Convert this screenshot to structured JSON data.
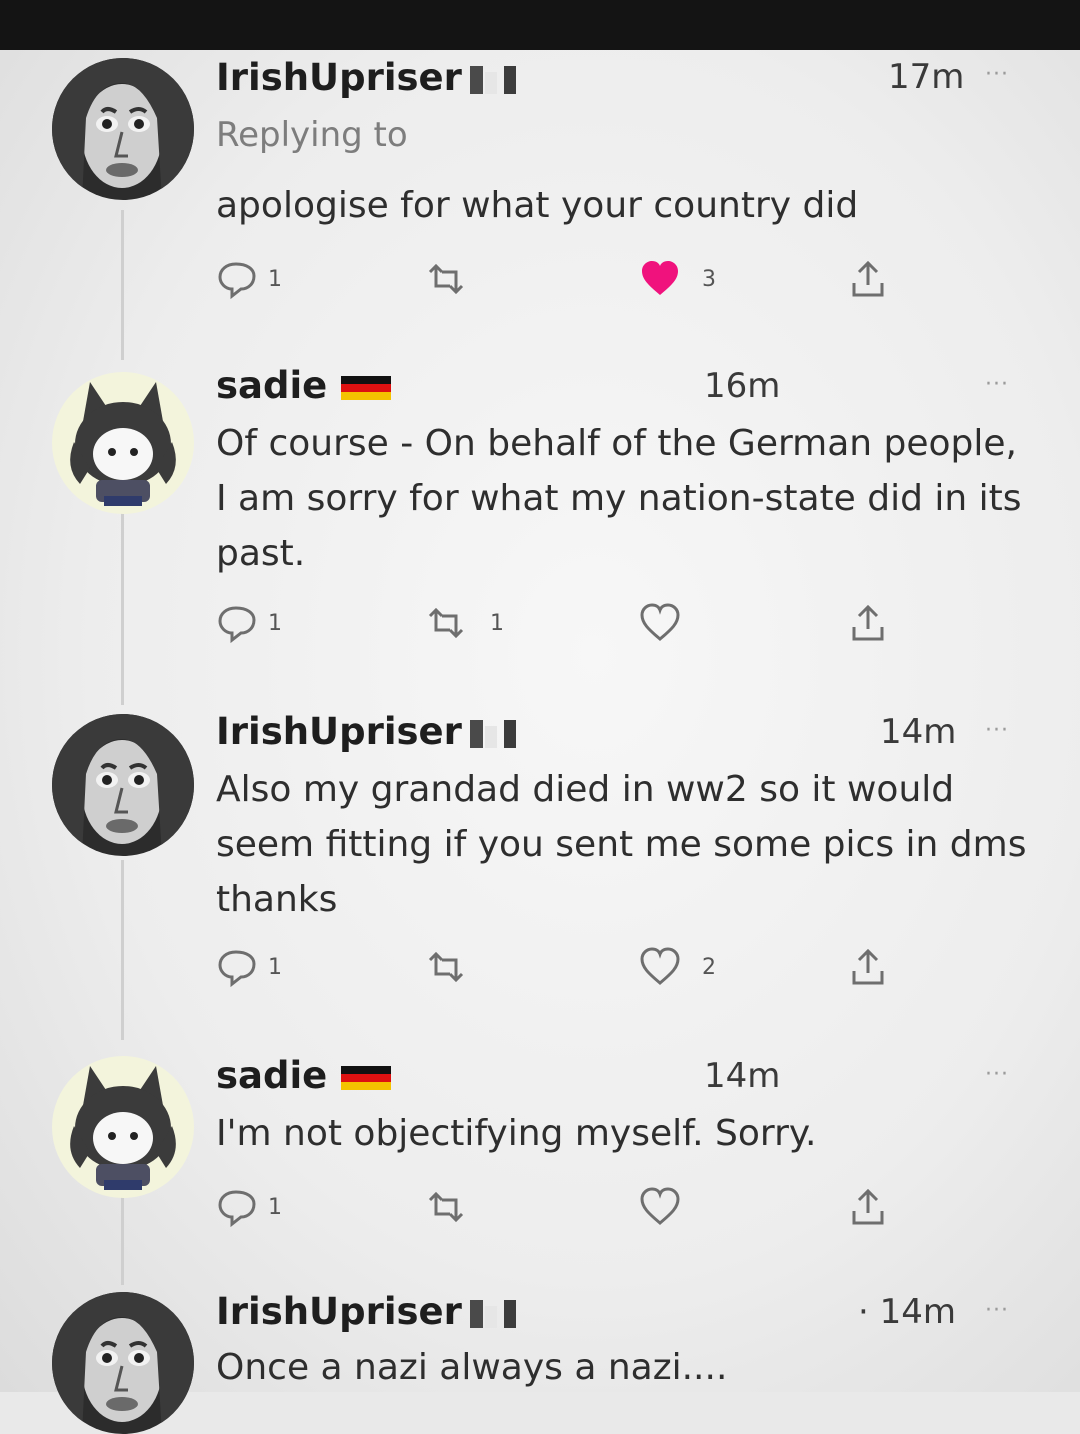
{
  "tweets": [
    {
      "name": "IrishUpriser",
      "time": "17m",
      "replying": "Replying to",
      "text": "apologise for what your country did",
      "flag": "ireland-flag",
      "replies": "1",
      "retweets": "",
      "likes": "3",
      "liked": true
    },
    {
      "name": "sadie",
      "time": "16m",
      "text": "Of course - On behalf of the German people, I am sorry for what my nation-state did in its past.",
      "flag": "germany-flag",
      "replies": "1",
      "retweets": "1",
      "likes": "",
      "liked": false
    },
    {
      "name": "IrishUpriser",
      "time": "14m",
      "text": "Also my grandad died in ww2 so it would seem fitting if you sent me some pics in dms thanks",
      "flag": "ireland-flag",
      "replies": "1",
      "retweets": "",
      "likes": "2",
      "liked": false
    },
    {
      "name": "sadie",
      "time": "14m",
      "text": "I'm not objectifying myself. Sorry.",
      "flag": "germany-flag",
      "replies": "1",
      "retweets": "",
      "likes": "",
      "liked": false
    },
    {
      "name": "IrishUpriser",
      "time": "· 14m",
      "text": "Once a nazi always a nazi....",
      "flag": "ireland-flag"
    }
  ],
  "more_label": "···",
  "colors": {
    "like_active": "#f0127d",
    "background": "#ededed",
    "topbar": "#141414"
  }
}
